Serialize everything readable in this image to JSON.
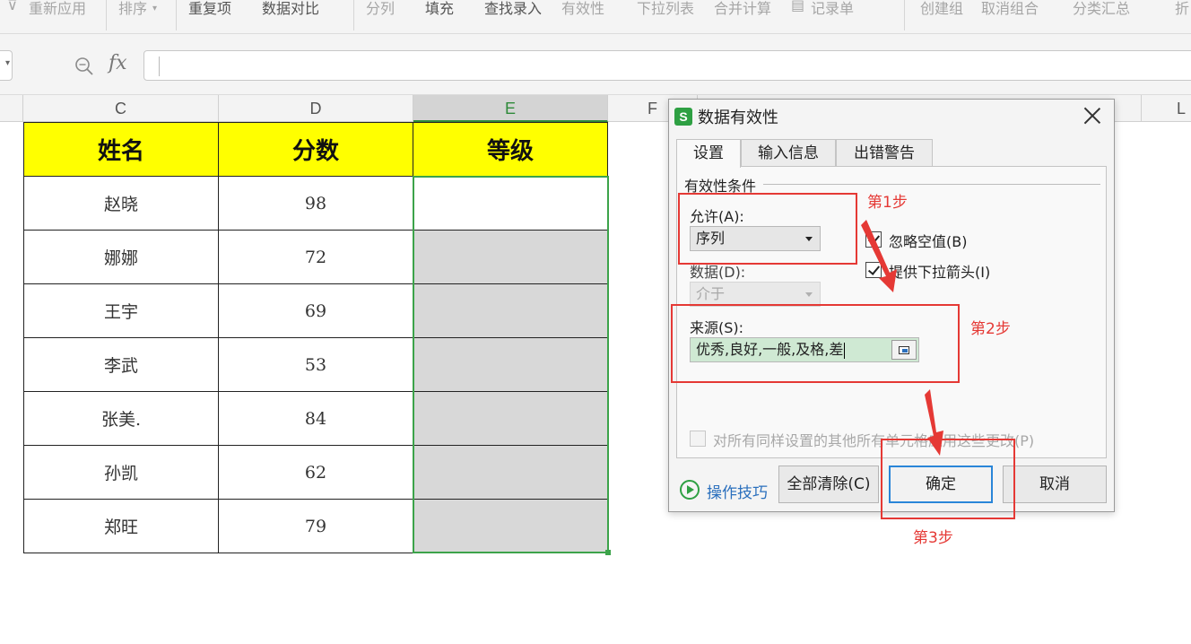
{
  "ribbon": {
    "items": [
      "重新应用",
      "排序",
      "重复项",
      "数据对比",
      "分列",
      "填充",
      "查找录入",
      "有效性",
      "下拉列表",
      "合并计算",
      "记录单",
      "创建组",
      "取消组合",
      "分类汇总",
      "折"
    ]
  },
  "formula_bar": {
    "fx_label": "fx",
    "value": ""
  },
  "columns": [
    "C",
    "D",
    "E",
    "F",
    "L"
  ],
  "table": {
    "headers": [
      "姓名",
      "分数",
      "等级"
    ],
    "rows": [
      [
        "赵晓",
        "98",
        ""
      ],
      [
        "娜娜",
        "72",
        ""
      ],
      [
        "王宇",
        "69",
        ""
      ],
      [
        "李武",
        "53",
        ""
      ],
      [
        "张美.",
        "84",
        ""
      ],
      [
        "孙凯",
        "62",
        ""
      ],
      [
        "郑旺",
        "79",
        ""
      ]
    ]
  },
  "dialog": {
    "logo": "S",
    "title": "数据有效性",
    "tabs": [
      "设置",
      "输入信息",
      "出错警告"
    ],
    "group_label": "有效性条件",
    "allow_label": "允许(A):",
    "allow_value": "序列",
    "data_label": "数据(D):",
    "data_value": "介于",
    "ignore_blank_label": "忽略空值(B)",
    "ignore_blank_checked": true,
    "dropdown_label": "提供下拉箭头(I)",
    "dropdown_checked": true,
    "source_label": "来源(S):",
    "source_value": "优秀,良好,一般,及格,差",
    "apply_all_label": "对所有同样设置的其他所有单元格应用这些更改(P)",
    "apply_all_checked": false,
    "help_link": "操作技巧",
    "clear_button": "全部清除(C)",
    "ok_button": "确定",
    "cancel_button": "取消"
  },
  "annotations": {
    "step1": "第1步",
    "step2": "第2步",
    "step3": "第3步",
    "color": "#e53935"
  },
  "colors": {
    "header_fill": "#ffff00",
    "selection": "#3ca34a",
    "link": "#2a6fbd",
    "primary_button_border": "#2a86d8"
  }
}
